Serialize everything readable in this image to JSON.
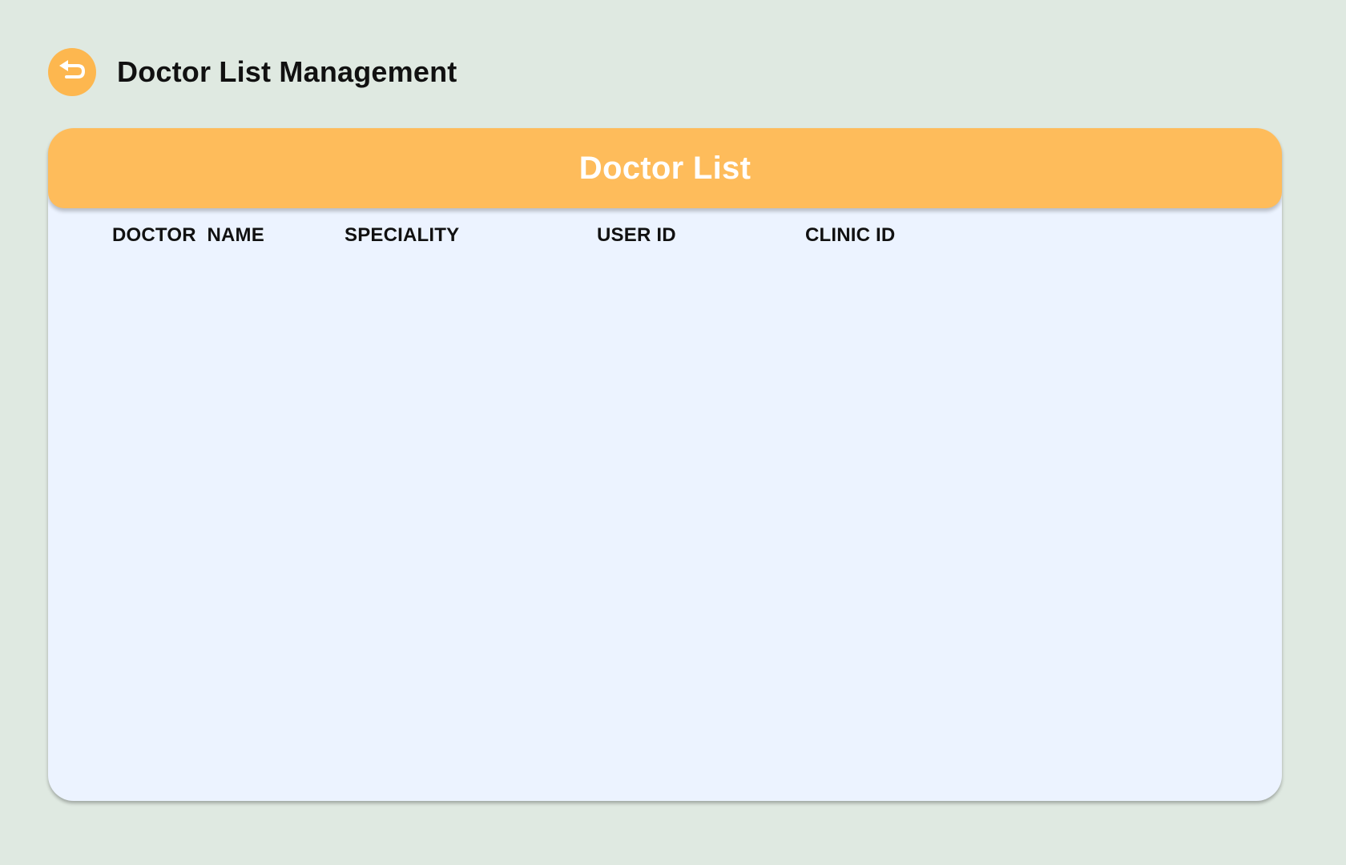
{
  "header": {
    "back_icon": "back-arrow-icon",
    "title": "Doctor List Management"
  },
  "card": {
    "title": "Doctor List",
    "columns": [
      "DOCTOR  NAME",
      "SPECIALITY",
      "USER ID",
      "CLINIC ID"
    ],
    "rows": []
  },
  "colors": {
    "background": "#dfe9e1",
    "accent": "#febc5b",
    "card_background": "#ecf3ff"
  }
}
